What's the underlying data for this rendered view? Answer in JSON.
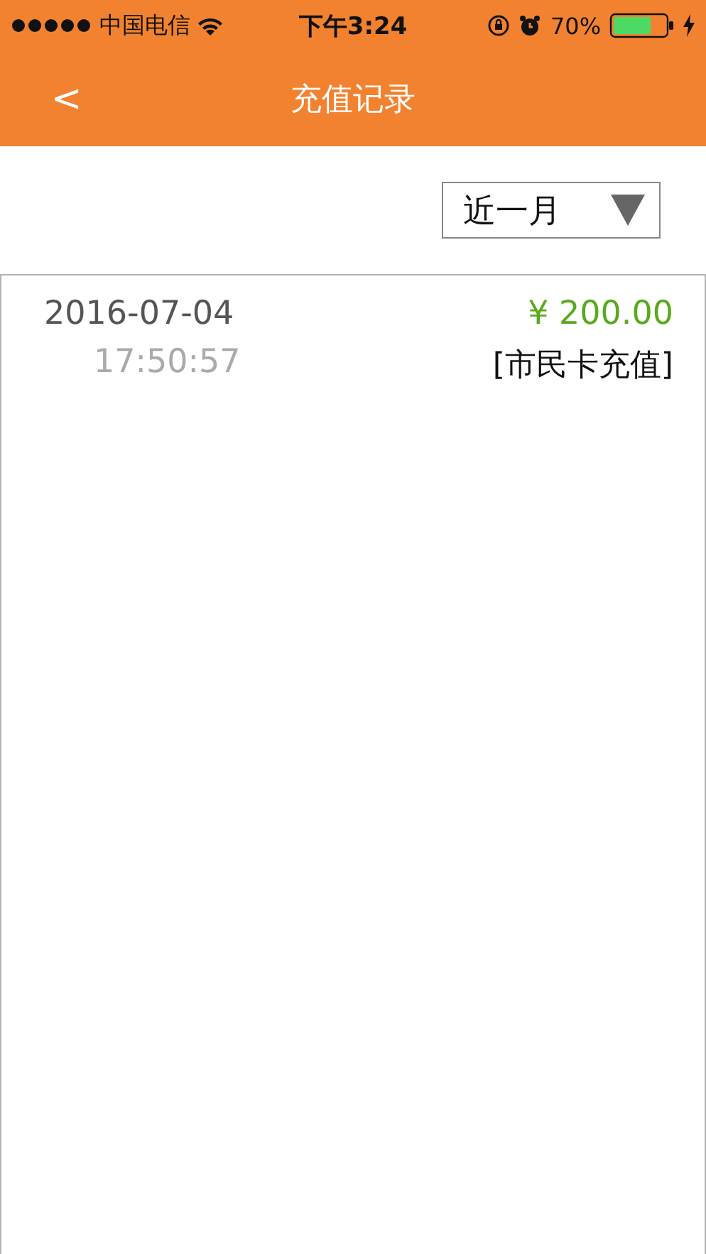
{
  "status_bar": {
    "carrier": "中国电信",
    "time": "下午3:24",
    "battery": "70%"
  },
  "nav": {
    "back": "<",
    "title": "充值记录"
  },
  "filter": {
    "value": "近一月"
  },
  "records": [
    {
      "date": "2016-07-04",
      "time": "17:50:57",
      "amount": "¥ 200.00",
      "type": "[市民卡充值]"
    }
  ]
}
